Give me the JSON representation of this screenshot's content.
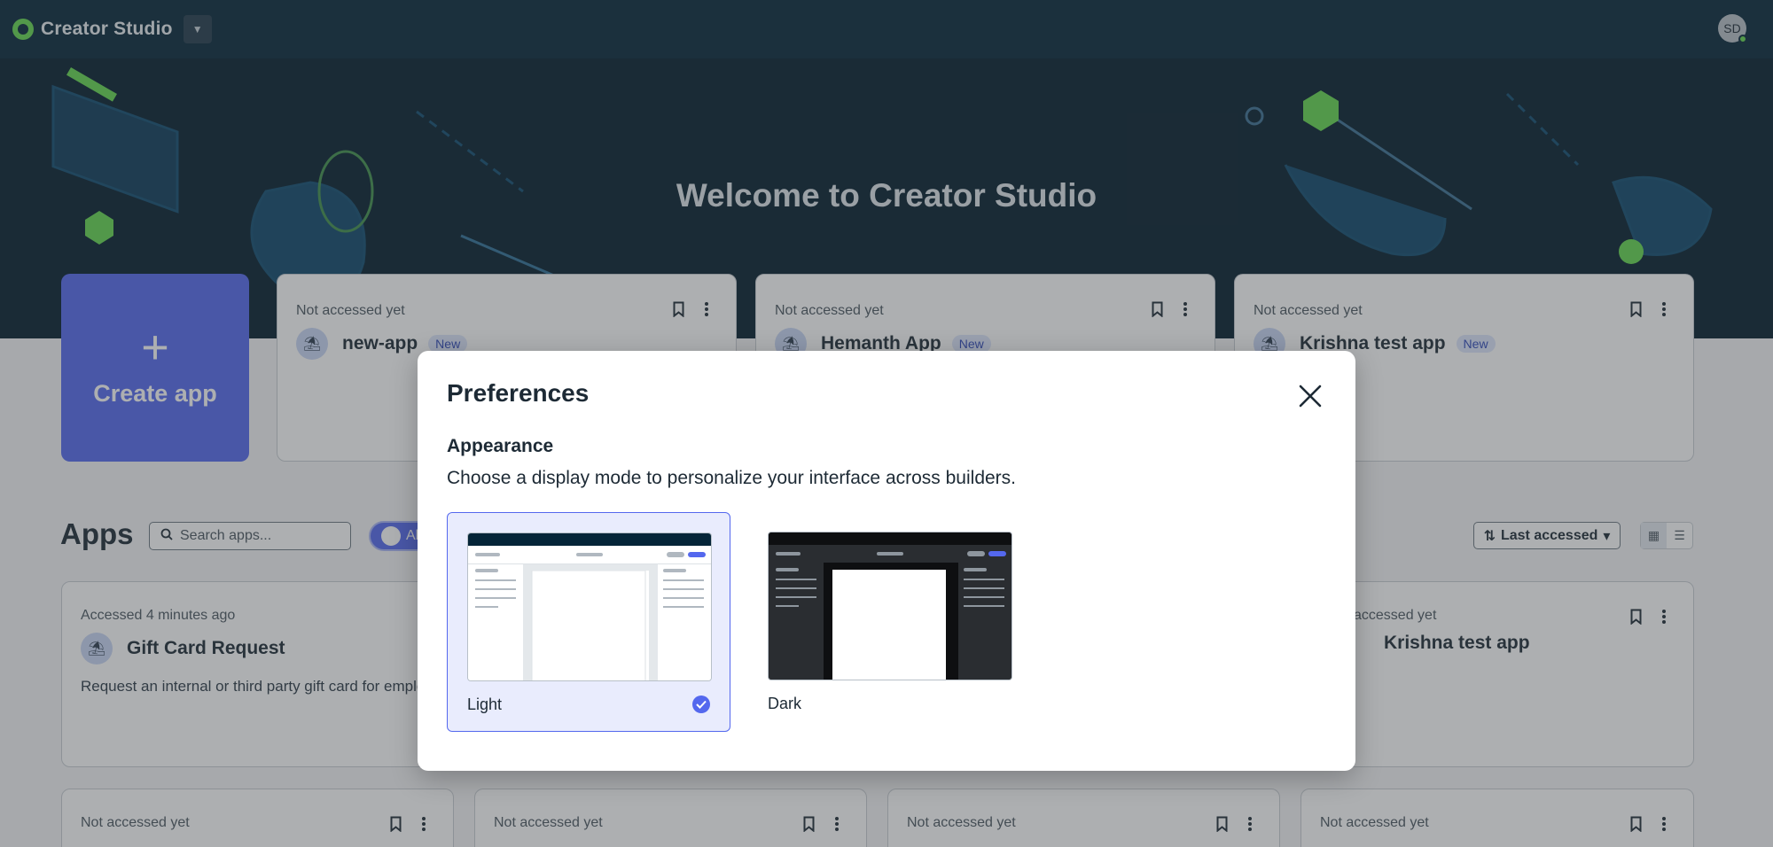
{
  "topbar": {
    "brand": "Creator Studio",
    "menu_icon": "chevron-down-icon",
    "user_initials": "SD"
  },
  "hero": {
    "title": "Welcome to Creator Studio"
  },
  "create_app": {
    "label": "Create app"
  },
  "recent_cards": [
    {
      "meta": "Not accessed yet",
      "title": "new-app",
      "badge": "New"
    },
    {
      "meta": "Not accessed yet",
      "title": "Hemanth App",
      "badge": "New"
    },
    {
      "meta": "Not accessed yet",
      "title": "Krishna test app",
      "badge": "New"
    }
  ],
  "apps_section": {
    "heading": "Apps",
    "search_placeholder": "Search apps...",
    "filter_label": "All",
    "sort_label": "Last accessed"
  },
  "app_cards": [
    {
      "meta": "Accessed 4 minutes ago",
      "title": "Gift Card Request",
      "description": "Request an internal or third party gift card for employee recognition."
    },
    {
      "meta": "accessed yet",
      "title": "Krishna test app",
      "description": ""
    }
  ],
  "bottom_cards": [
    {
      "meta": "Not accessed yet"
    },
    {
      "meta": "Not accessed yet"
    },
    {
      "meta": "Not accessed yet"
    },
    {
      "meta": "Not accessed yet"
    }
  ],
  "modal": {
    "title": "Preferences",
    "section_title": "Appearance",
    "section_description": "Choose a display mode to personalize your interface across builders.",
    "options": [
      {
        "label": "Light",
        "selected": true
      },
      {
        "label": "Dark",
        "selected": false
      }
    ]
  },
  "colors": {
    "topbar": "#052538",
    "accent": "#5468ee",
    "brand_green": "#62d84e"
  }
}
